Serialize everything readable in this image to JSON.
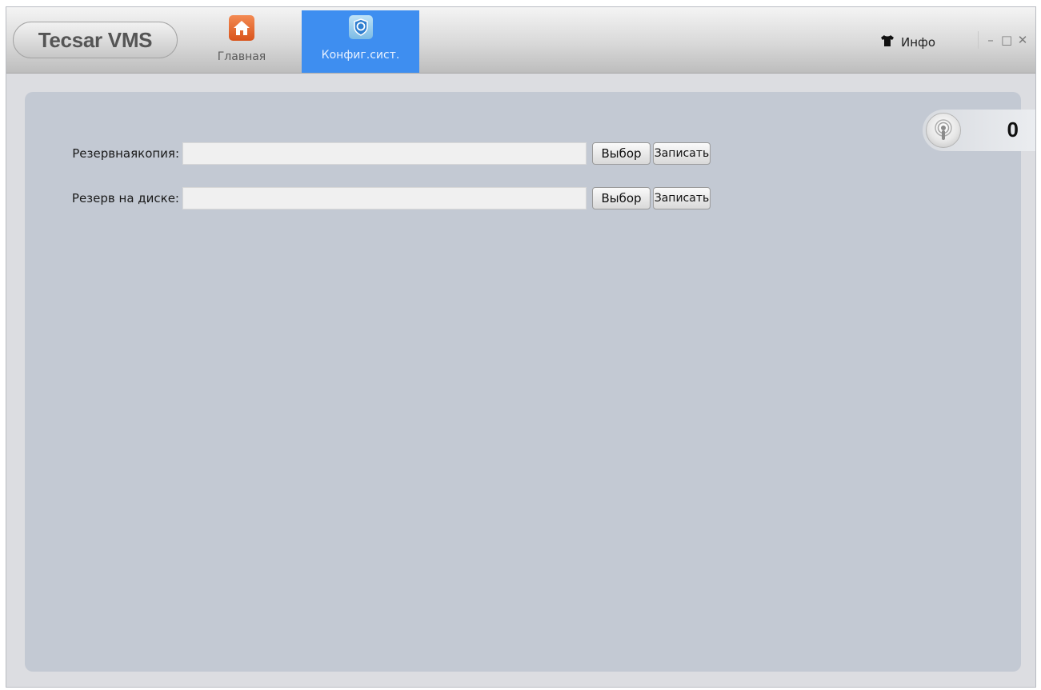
{
  "app": {
    "title": "Tecsar VMS"
  },
  "tabs": [
    {
      "label": "Главная",
      "icon": "home-icon",
      "active": false
    },
    {
      "label": "Конфиг.сист.",
      "icon": "system-config-icon",
      "active": true
    }
  ],
  "header": {
    "info_label": "Инфо",
    "info_icon": "shirt-icon",
    "controls": {
      "minimize": "–",
      "maximize": "□",
      "close": "✕"
    }
  },
  "form": {
    "rows": [
      {
        "label": "Резервнаякопия:",
        "value": "",
        "select_label": "Выбор",
        "write_label": "Записать"
      },
      {
        "label": "Резерв на диске:",
        "value": "",
        "select_label": "Выбор",
        "write_label": "Записать"
      }
    ]
  },
  "alarm": {
    "count": "0",
    "icon": "alarm-speaker-icon"
  },
  "colors": {
    "active_tab": "#3e8ef0",
    "home_icon_bg": "#e8672c",
    "panel_bg": "#c3c9d3",
    "window_bg": "#dcdde1"
  }
}
